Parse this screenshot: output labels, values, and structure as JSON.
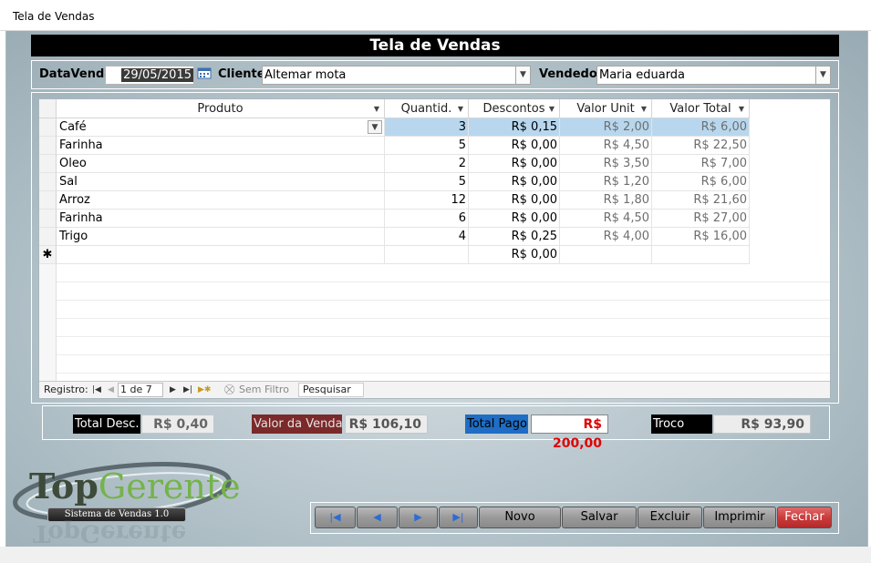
{
  "window": {
    "title": "Tela de Vendas"
  },
  "form": {
    "header": "Tela de Vendas",
    "data_venda_label": "DataVenda",
    "data_venda_value": "29/05/2015",
    "cliente_label": "Cliente",
    "cliente_value": "Altemar mota",
    "vendedor_label": "Vendedor",
    "vendedor_value": "Maria eduarda"
  },
  "grid": {
    "columns": [
      "Produto",
      "Quantid.",
      "Descontos",
      "Valor Unit",
      "Valor Total"
    ],
    "rows": [
      {
        "produto": "Café",
        "quantid": "3",
        "descontos": "R$ 0,15",
        "valor_unit": "R$ 2,00",
        "valor_total": "R$ 6,00"
      },
      {
        "produto": "Farinha",
        "quantid": "5",
        "descontos": "R$ 0,00",
        "valor_unit": "R$ 4,50",
        "valor_total": "R$ 22,50"
      },
      {
        "produto": "Oleo",
        "quantid": "2",
        "descontos": "R$ 0,00",
        "valor_unit": "R$ 3,50",
        "valor_total": "R$ 7,00"
      },
      {
        "produto": "Sal",
        "quantid": "5",
        "descontos": "R$ 0,00",
        "valor_unit": "R$ 1,20",
        "valor_total": "R$ 6,00"
      },
      {
        "produto": "Arroz",
        "quantid": "12",
        "descontos": "R$ 0,00",
        "valor_unit": "R$ 1,80",
        "valor_total": "R$ 21,60"
      },
      {
        "produto": "Farinha",
        "quantid": "6",
        "descontos": "R$ 0,00",
        "valor_unit": "R$ 4,50",
        "valor_total": "R$ 27,00"
      },
      {
        "produto": "Trigo",
        "quantid": "4",
        "descontos": "R$ 0,25",
        "valor_unit": "R$ 4,00",
        "valor_total": "R$ 16,00"
      }
    ],
    "new_row_symbol": "✱",
    "new_row_descontos": "R$ 0,00"
  },
  "navigator": {
    "registro_label": "Registro:",
    "position": "1 de 7",
    "filter_label": "Sem Filtro",
    "search_label": "Pesquisar"
  },
  "totals": {
    "total_desc_label": "Total Desc.",
    "total_desc_value": "R$ 0,40",
    "valor_venda_label": "Valor da Venda",
    "valor_venda_value": "R$ 106,10",
    "total_pago_label": "Total Pago",
    "total_pago_value": "R$ 200,00",
    "troco_label": "Troco",
    "troco_value": "R$ 93,90"
  },
  "logo": {
    "brand_top": "Top",
    "brand_main": "Gerente",
    "subtitle": "Sistema de Vendas 1.0"
  },
  "buttons": {
    "novo": "Novo",
    "salvar": "Salvar",
    "excluir": "Excluir",
    "imprimir": "Imprimir",
    "fechar": "Fechar"
  },
  "colors": {
    "header_bg": "#000000",
    "valor_venda_label_bg": "#7a2a2a",
    "total_pago_label_bg": "#1f6dc4",
    "total_pago_value": "#e00000",
    "fechar_bg": "#c83535",
    "nav_icon": "#2d6bd6"
  },
  "icons": [
    "calendar-icon",
    "chevron-down-icon",
    "first-record-icon",
    "previous-record-icon",
    "next-record-icon",
    "last-record-icon",
    "new-record-icon",
    "filter-icon"
  ]
}
